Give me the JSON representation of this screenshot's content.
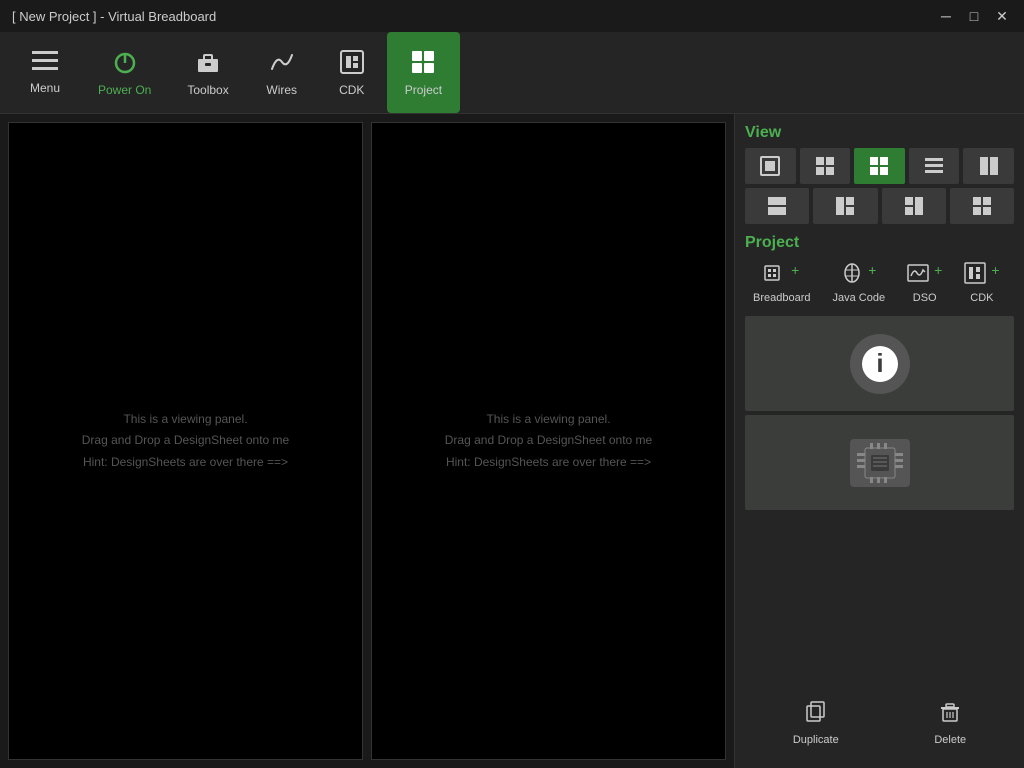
{
  "titlebar": {
    "title": "[ New Project ] - Virtual Breadboard",
    "min_label": "─",
    "max_label": "□",
    "close_label": "✕"
  },
  "toolbar": {
    "items": [
      {
        "id": "menu",
        "label": "Menu",
        "icon": "☰"
      },
      {
        "id": "power-on",
        "label": "Power On",
        "icon": "⏻",
        "green": true
      },
      {
        "id": "toolbox",
        "label": "Toolbox",
        "icon": "⚙"
      },
      {
        "id": "wires",
        "label": "Wires",
        "icon": "~"
      },
      {
        "id": "cdk",
        "label": "CDK",
        "icon": "⬜"
      },
      {
        "id": "project",
        "label": "Project",
        "icon": "⊞",
        "active": true
      }
    ]
  },
  "panels": {
    "hint_line1": "This is a viewing panel.",
    "hint_line2": "Drag and Drop a DesignSheet onto me",
    "hint_line3": "Hint: DesignSheets are over there ==>"
  },
  "sidebar": {
    "view_label": "View",
    "project_label": "Project",
    "view_buttons_row1": [
      {
        "id": "v1",
        "icon": "▣",
        "active": false
      },
      {
        "id": "v2",
        "icon": "⊞",
        "active": false
      },
      {
        "id": "v3",
        "icon": "⊡",
        "active": true
      },
      {
        "id": "v4",
        "icon": "≡",
        "active": false
      },
      {
        "id": "v5",
        "icon": "⊟",
        "active": false
      }
    ],
    "view_buttons_row2": [
      {
        "id": "v6",
        "icon": "▬",
        "active": false
      },
      {
        "id": "v7",
        "icon": "⊞",
        "active": false
      },
      {
        "id": "v8",
        "icon": "⊠",
        "active": false
      },
      {
        "id": "v9",
        "icon": "⊞",
        "active": false
      }
    ],
    "project_actions": [
      {
        "id": "breadboard",
        "label": "Breadboard",
        "icon": "⊞"
      },
      {
        "id": "java-code",
        "label": "Java Code",
        "icon": "☕"
      },
      {
        "id": "dso",
        "label": "DSO",
        "icon": "∿"
      },
      {
        "id": "cdk",
        "label": "CDK",
        "icon": "⬜"
      }
    ],
    "duplicate_label": "Duplicate",
    "delete_label": "Delete"
  }
}
